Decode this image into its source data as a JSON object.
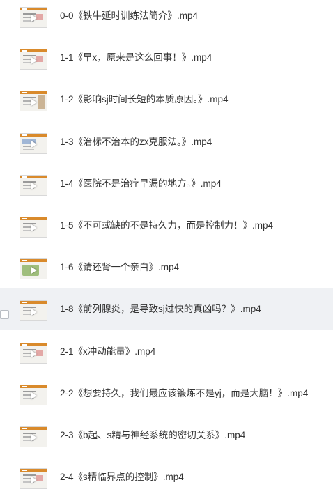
{
  "files": [
    {
      "name": "0-0《铁牛延时训练法简介》.mp4",
      "thumb": "slide-red"
    },
    {
      "name": "1-1《早x，原来是这么回事！》.mp4",
      "thumb": "slide-red"
    },
    {
      "name": "1-2《影响sj时间长短的本质原因。》.mp4",
      "thumb": "slide-brown"
    },
    {
      "name": "1-3《治标不治本的zx克服法。》.mp4",
      "thumb": "slide-blue"
    },
    {
      "name": "1-4《医院不是治疗早漏的地方。》.mp4",
      "thumb": "slide-plain"
    },
    {
      "name": "1-5《不可或缺的不是持久力，而是控制力！》.mp4",
      "thumb": "slide-plain"
    },
    {
      "name": "1-6《请还肾一个亲白》.mp4",
      "thumb": "slide-green"
    },
    {
      "name": "1-8《前列腺炎，是导致sj过快的真凶吗？》.mp4",
      "thumb": "slide-plain",
      "hovered": true
    },
    {
      "name": "2-1《x冲动能量》.mp4",
      "thumb": "slide-red"
    },
    {
      "name": "2-2《想要持久，我们最应该锻炼不是yj，而是大脑！》.mp4",
      "thumb": "slide-plain"
    },
    {
      "name": "2-3《b起、s精与神经系统的密切关系》.mp4",
      "thumb": "slide-plain"
    },
    {
      "name": "2-4《s精临界点的控制》.mp4",
      "thumb": "slide-red"
    }
  ],
  "colors": {
    "thumb_header": "#d98a2b",
    "hover_row": "#eff1f4",
    "text": "#333333"
  },
  "icons": {
    "play": "play-icon",
    "checkbox": "checkbox"
  }
}
